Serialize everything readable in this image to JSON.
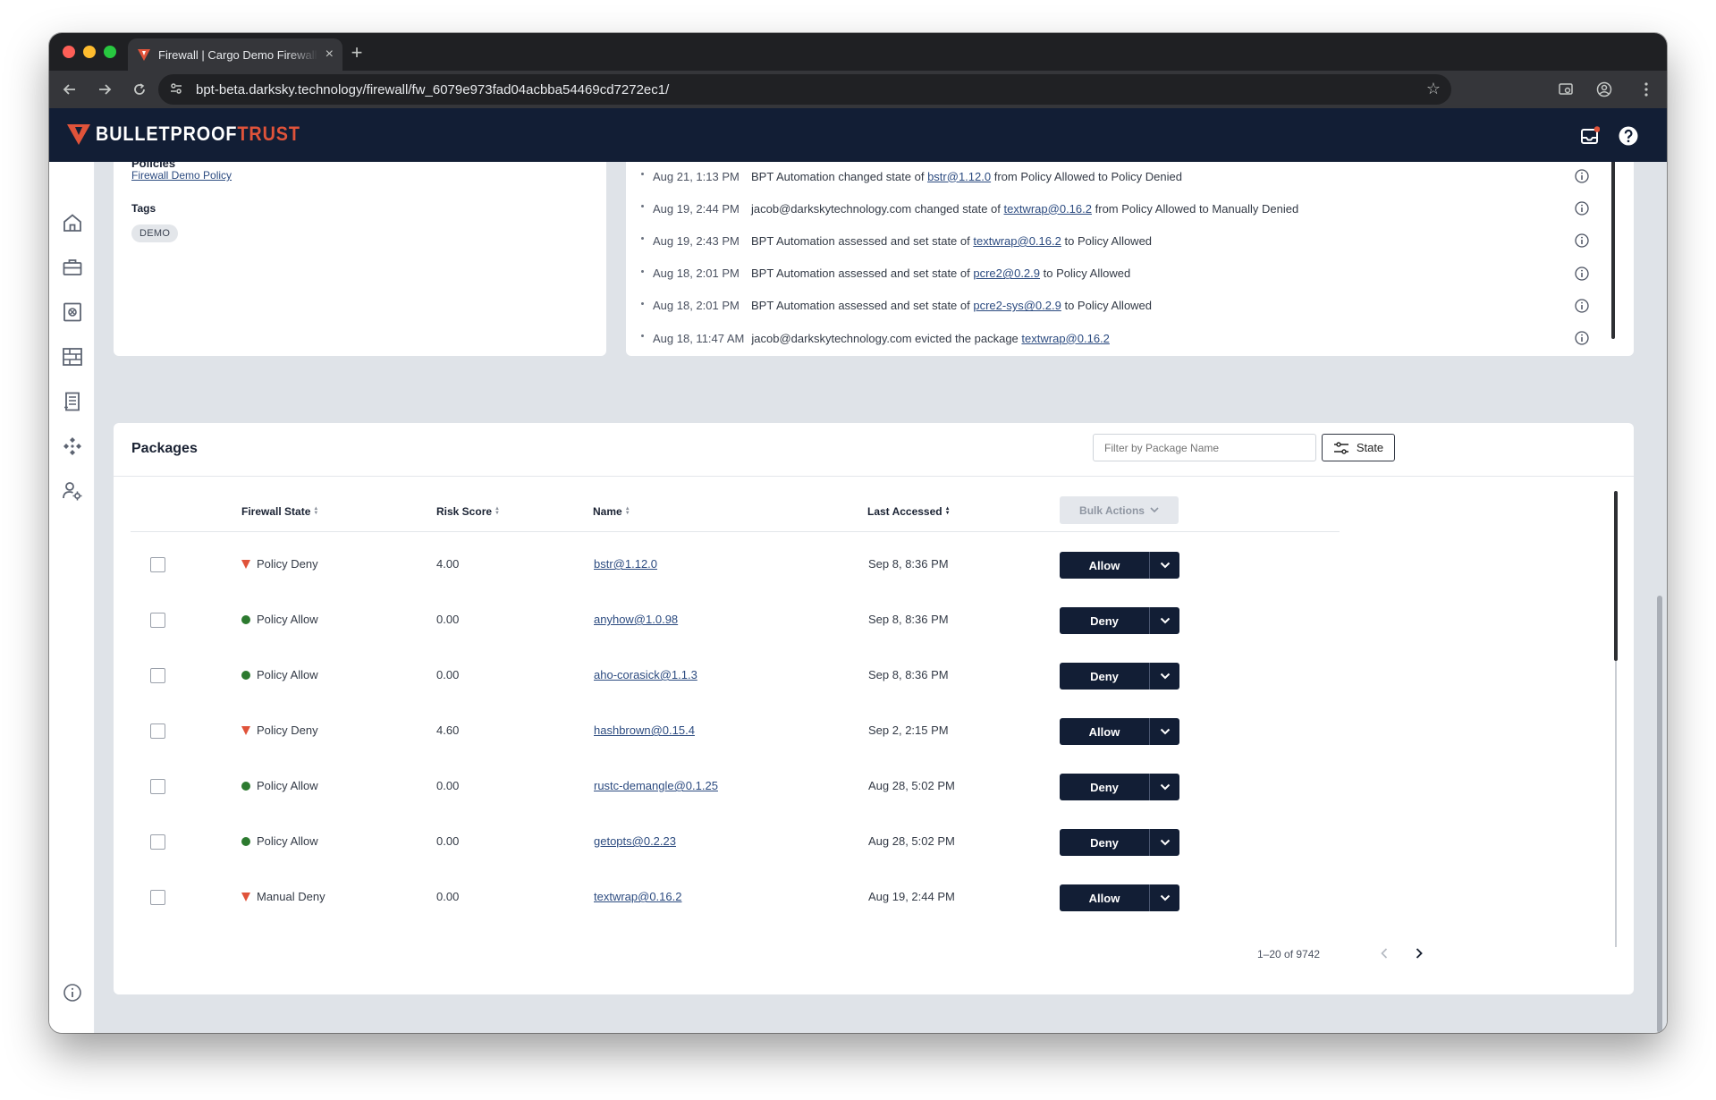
{
  "browser": {
    "tab_title": "Firewall | Cargo Demo Firewall",
    "url": "bpt-beta.darksky.technology/firewall/fw_6079e973fad04acbba54469cd7272ec1/"
  },
  "brand": {
    "name_part1": "BULLETPROOF",
    "name_part2": "TRUST",
    "accent": "#e0533a",
    "navy": "#121e35"
  },
  "details": {
    "policies_label": "Policies",
    "policy_link": "Firewall Demo Policy",
    "tags_label": "Tags",
    "tag": "DEMO"
  },
  "activity": [
    {
      "time": "Aug 21, 1:13 PM",
      "pre": "BPT Automation changed state of",
      "link": "bstr@1.12.0",
      "post": "from Policy Allowed to Policy Denied"
    },
    {
      "time": "Aug 19, 2:44 PM",
      "pre": "jacob@darkskytechnology.com changed state of",
      "link": "textwrap@0.16.2",
      "post": "from Policy Allowed to Manually Denied"
    },
    {
      "time": "Aug 19, 2:43 PM",
      "pre": "BPT Automation assessed and set state of",
      "link": "textwrap@0.16.2",
      "post": "to Policy Allowed"
    },
    {
      "time": "Aug 18, 2:01 PM",
      "pre": "BPT Automation assessed and set state of",
      "link": "pcre2@0.2.9",
      "post": "to Policy Allowed"
    },
    {
      "time": "Aug 18, 2:01 PM",
      "pre": "BPT Automation assessed and set state of",
      "link": "pcre2-sys@0.2.9",
      "post": "to Policy Allowed"
    },
    {
      "time": "Aug 18, 11:47 AM",
      "pre": "jacob@darkskytechnology.com evicted the package",
      "link": "textwrap@0.16.2",
      "post": ""
    }
  ],
  "packages": {
    "title": "Packages",
    "filter_placeholder": "Filter by Package Name",
    "state_button": "State",
    "columns": {
      "state": "Firewall State",
      "risk": "Risk Score",
      "name": "Name",
      "accessed": "Last Accessed"
    },
    "bulk_actions": "Bulk Actions",
    "rows": [
      {
        "state": "Policy Deny",
        "status": "deny",
        "risk": "4.00",
        "name": "bstr@1.12.0",
        "accessed": "Sep 8, 8:36 PM",
        "action": "Allow"
      },
      {
        "state": "Policy Allow",
        "status": "allow",
        "risk": "0.00",
        "name": "anyhow@1.0.98",
        "accessed": "Sep 8, 8:36 PM",
        "action": "Deny"
      },
      {
        "state": "Policy Allow",
        "status": "allow",
        "risk": "0.00",
        "name": "aho-corasick@1.1.3",
        "accessed": "Sep 8, 8:36 PM",
        "action": "Deny"
      },
      {
        "state": "Policy Deny",
        "status": "deny",
        "risk": "4.60",
        "name": "hashbrown@0.15.4",
        "accessed": "Sep 2, 2:15 PM",
        "action": "Allow"
      },
      {
        "state": "Policy Allow",
        "status": "allow",
        "risk": "0.00",
        "name": "rustc-demangle@0.1.25",
        "accessed": "Aug 28, 5:02 PM",
        "action": "Deny"
      },
      {
        "state": "Policy Allow",
        "status": "allow",
        "risk": "0.00",
        "name": "getopts@0.2.23",
        "accessed": "Aug 28, 5:02 PM",
        "action": "Deny"
      },
      {
        "state": "Manual Deny",
        "status": "deny",
        "risk": "0.00",
        "name": "textwrap@0.16.2",
        "accessed": "Aug 19, 2:44 PM",
        "action": "Allow"
      }
    ],
    "pagination": "1–20 of 9742"
  }
}
